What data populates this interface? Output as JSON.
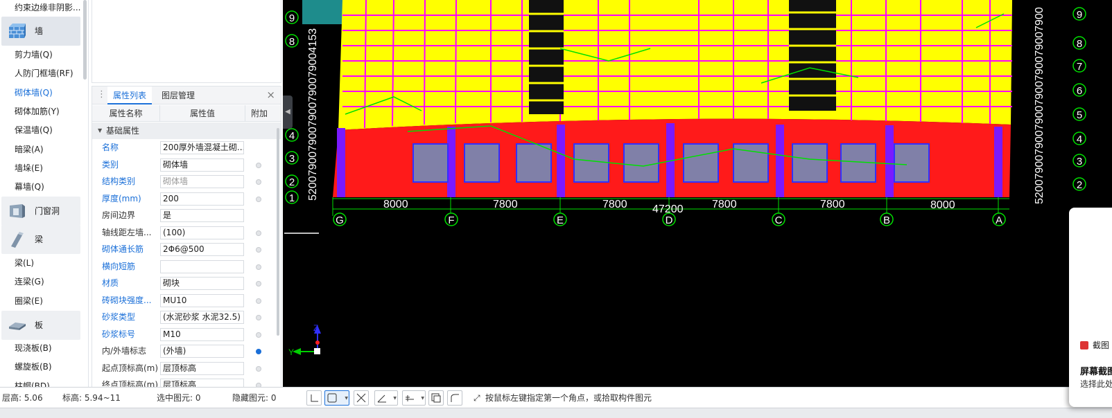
{
  "tree": {
    "top_item": "约束边缘非阴影...",
    "wall_category": "墙",
    "wall_items": [
      "剪力墙(Q)",
      "人防门框墙(RF)",
      "砌体墙(Q)",
      "砌体加筋(Y)",
      "保温墙(Q)",
      "暗梁(A)",
      "墙垛(E)",
      "幕墙(Q)"
    ],
    "door_category": "门窗洞",
    "beam_category": "梁",
    "beam_items": [
      "梁(L)",
      "连梁(G)",
      "圈梁(E)"
    ],
    "slab_category": "板",
    "slab_items": [
      "现浇板(B)",
      "螺旋板(B)",
      "柱帽(BD)"
    ]
  },
  "panel": {
    "tab_active": "属性列表",
    "tab_other": "图层管理",
    "col_name": "属性名称",
    "col_value": "属性值",
    "col_extra": "附加",
    "group": "基础属性",
    "rows": [
      {
        "name": "名称",
        "value": "200厚外墙混凝土砌..."
      },
      {
        "name": "类别",
        "value": "砌体墙"
      },
      {
        "name": "结构类别",
        "value": "砌体墙"
      },
      {
        "name": "厚度(mm)",
        "value": "200"
      },
      {
        "name": "房间边界",
        "value": "是"
      },
      {
        "name": "轴线距左墙...",
        "value": "(100)"
      },
      {
        "name": "砌体通长筋",
        "value": "2Φ6@500"
      },
      {
        "name": "横向短筋",
        "value": ""
      },
      {
        "name": "材质",
        "value": "砌块"
      },
      {
        "name": "砖砌块强度...",
        "value": "MU10"
      },
      {
        "name": "砂浆类型",
        "value": "(水泥砂浆 水泥32.5)"
      },
      {
        "name": "砂浆标号",
        "value": "M10"
      },
      {
        "name": "内/外墙标志",
        "value": "(外墙)"
      },
      {
        "name": "起点顶标高(m)",
        "value": "层顶标高"
      },
      {
        "name": "终点顶标高(m)",
        "value": "层顶标高"
      }
    ]
  },
  "drawing": {
    "dims_bottom": [
      "8000",
      "7800",
      "7800",
      "7800",
      "7800",
      "8000"
    ],
    "total_dim": "47200",
    "axes_letters": [
      "G",
      "F",
      "E",
      "D",
      "C",
      "B",
      "A"
    ],
    "axes_numbers": [
      "9",
      "8",
      "7",
      "6",
      "5",
      "4",
      "3",
      "2",
      "1"
    ],
    "left_vertical_dims": "5200790079007900790079004153",
    "right_vertical_dims": "52007900790079007900790079007900",
    "y_axis_label": "Y",
    "z_axis_label": "Z",
    "colors": {
      "wall_fill": "#ff1a1a",
      "slab_fill": "#ffff00",
      "axis_green": "#00d000",
      "magenta": "#ff00ff",
      "blue": "#4040ff"
    }
  },
  "status": {
    "floor_height": "层高: 5.06",
    "elevation": "标高: 5.94~11",
    "selected": "选中图元: 0",
    "hidden": "隐藏图元: 0",
    "hint": "按鼠标左键指定第一个角点，或拾取构件图元"
  },
  "toast": {
    "app": "截图",
    "title": "屏幕截图",
    "subtitle": "选择此处"
  }
}
